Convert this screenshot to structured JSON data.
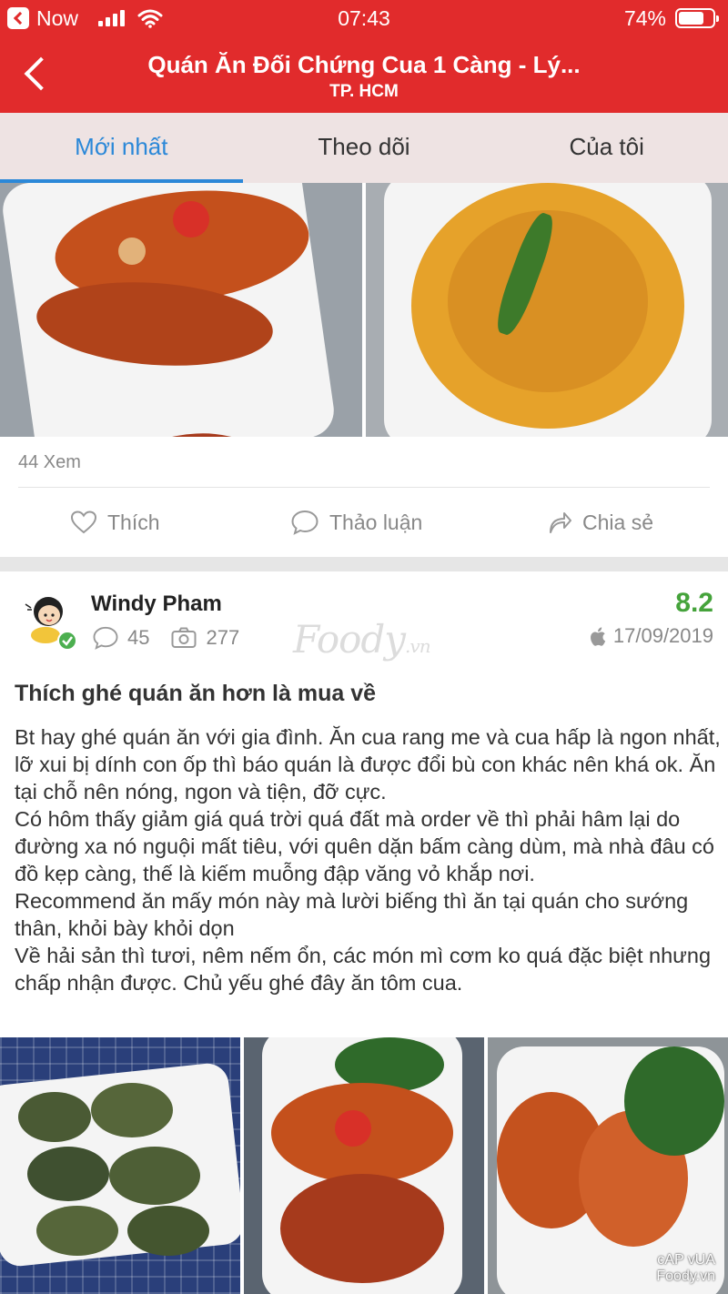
{
  "status_bar": {
    "back_app_label": "Now",
    "time": "07:43",
    "battery": "74%",
    "battery_level": 0.74
  },
  "nav": {
    "title": "Quán Ăn Đối Chứng Cua 1 Càng - Lý...",
    "subtitle": "TP. HCM"
  },
  "tabs": [
    {
      "label": "Mới nhất",
      "active": true
    },
    {
      "label": "Theo dõi",
      "active": false
    },
    {
      "label": "Của tôi",
      "active": false
    }
  ],
  "post": {
    "views": "44 Xem",
    "actions": {
      "like": "Thích",
      "discuss": "Thảo luận",
      "share": "Chia sẻ"
    }
  },
  "review": {
    "user_name": "Windy Pham",
    "comments_count": "45",
    "photos_count": "277",
    "score": "8.2",
    "date": "17/09/2019",
    "watermark": "Foody",
    "watermark_suffix": ".vn",
    "title": "Thích ghé quán ăn hơn là mua về",
    "body": "Bt hay ghé quán ăn với gia đình. Ăn cua rang me và cua hấp là ngon nhất, lỡ xui bị dính con ốp thì báo quán là được đổi bù con khác nên khá ok. Ăn tại chỗ nên nóng, ngon và tiện, đỡ cực.\nCó hôm thấy giảm giá quá trời quá đất mà order về thì phải hâm lại do đường xa nó nguội mất tiêu, với quên dặn bấm càng dùm, mà nhà đâu có đồ kẹp càng, thế là kiếm muỗng đập văng vỏ khắp nơi.\nRecommend ăn mấy món này mà lười biếng thì ăn tại quán cho sướng thân, khỏi bày khỏi dọn\nVề hải sản thì tươi, nêm nếm ổn, các món mì cơm ko quá đặc biệt nhưng chấp nhận được. Chủ yếu ghé đây ăn tôm cua.",
    "photo_watermark_line1": "cAP vUA",
    "photo_watermark_line2": "Foody.vn"
  },
  "colors": {
    "brand_red": "#e12b2c",
    "tab_active_blue": "#2b88d8",
    "score_green": "#45a33b"
  },
  "icons": [
    "back-app-icon",
    "signal-icon",
    "wifi-icon",
    "battery-icon",
    "back-arrow-icon",
    "heart-icon",
    "comment-icon",
    "share-icon",
    "camera-icon",
    "apple-icon",
    "verified-icon"
  ]
}
